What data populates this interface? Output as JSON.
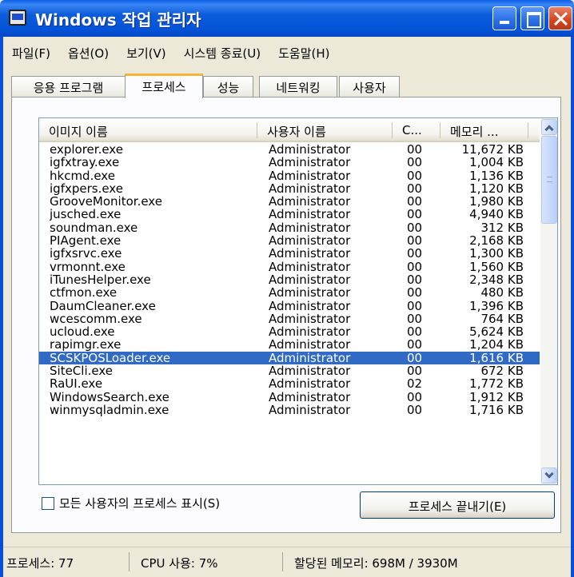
{
  "window": {
    "title": "Windows 작업 관리자"
  },
  "menu": [
    "파일(F)",
    "옵션(O)",
    "보기(V)",
    "시스템 종료(U)",
    "도움말(H)"
  ],
  "tabs": [
    {
      "label": "응용 프로그램"
    },
    {
      "label": "프로세스"
    },
    {
      "label": "성능"
    },
    {
      "label": "네트워킹"
    },
    {
      "label": "사용자"
    }
  ],
  "columns": {
    "name": "이미지 이름",
    "user": "사용자 이름",
    "cpu": "C...",
    "mem": "메모리 ..."
  },
  "processes": [
    {
      "name": "explorer.exe",
      "user": "Administrator",
      "cpu": "00",
      "mem": "11,672 KB"
    },
    {
      "name": "igfxtray.exe",
      "user": "Administrator",
      "cpu": "00",
      "mem": "1,004 KB"
    },
    {
      "name": "hkcmd.exe",
      "user": "Administrator",
      "cpu": "00",
      "mem": "1,136 KB"
    },
    {
      "name": "igfxpers.exe",
      "user": "Administrator",
      "cpu": "00",
      "mem": "1,120 KB"
    },
    {
      "name": "GrooveMonitor.exe",
      "user": "Administrator",
      "cpu": "00",
      "mem": "1,980 KB"
    },
    {
      "name": "jusched.exe",
      "user": "Administrator",
      "cpu": "00",
      "mem": "4,940 KB"
    },
    {
      "name": "soundman.exe",
      "user": "Administrator",
      "cpu": "00",
      "mem": "312 KB"
    },
    {
      "name": "PIAgent.exe",
      "user": "Administrator",
      "cpu": "00",
      "mem": "2,168 KB"
    },
    {
      "name": "igfxsrvc.exe",
      "user": "Administrator",
      "cpu": "00",
      "mem": "1,300 KB"
    },
    {
      "name": "vrmonnt.exe",
      "user": "Administrator",
      "cpu": "00",
      "mem": "1,560 KB"
    },
    {
      "name": "iTunesHelper.exe",
      "user": "Administrator",
      "cpu": "00",
      "mem": "2,348 KB"
    },
    {
      "name": "ctfmon.exe",
      "user": "Administrator",
      "cpu": "00",
      "mem": "480 KB"
    },
    {
      "name": "DaumCleaner.exe",
      "user": "Administrator",
      "cpu": "00",
      "mem": "1,396 KB"
    },
    {
      "name": "wcescomm.exe",
      "user": "Administrator",
      "cpu": "00",
      "mem": "764 KB"
    },
    {
      "name": "ucloud.exe",
      "user": "Administrator",
      "cpu": "00",
      "mem": "5,624 KB"
    },
    {
      "name": "rapimgr.exe",
      "user": "Administrator",
      "cpu": "00",
      "mem": "1,204 KB"
    },
    {
      "name": "SCSKPOSLoader.exe",
      "user": "Administrator",
      "cpu": "00",
      "mem": "1,616 KB",
      "selected": true
    },
    {
      "name": "SiteCli.exe",
      "user": "Administrator",
      "cpu": "00",
      "mem": "672 KB"
    },
    {
      "name": "RaUI.exe",
      "user": "Administrator",
      "cpu": "02",
      "mem": "1,772 KB"
    },
    {
      "name": "WindowsSearch.exe",
      "user": "Administrator",
      "cpu": "00",
      "mem": "1,912 KB"
    },
    {
      "name": "winmysqladmin.exe",
      "user": "Administrator",
      "cpu": "00",
      "mem": "1,716 KB"
    }
  ],
  "show_all_users": {
    "label": "모든 사용자의 프로세스 표시(S)",
    "checked": false
  },
  "end_process_label": "프로세스 끝내기(E)",
  "status": {
    "processes": "프로세스: 77",
    "cpu": "CPU 사용: 7%",
    "memory": "할당된 메모리: 698M / 3930M"
  },
  "colors": {
    "title_bar": "#0553D8",
    "selection": "#316AC5",
    "tab_accent": "#F7B43A",
    "close_button": "#D2451F"
  }
}
